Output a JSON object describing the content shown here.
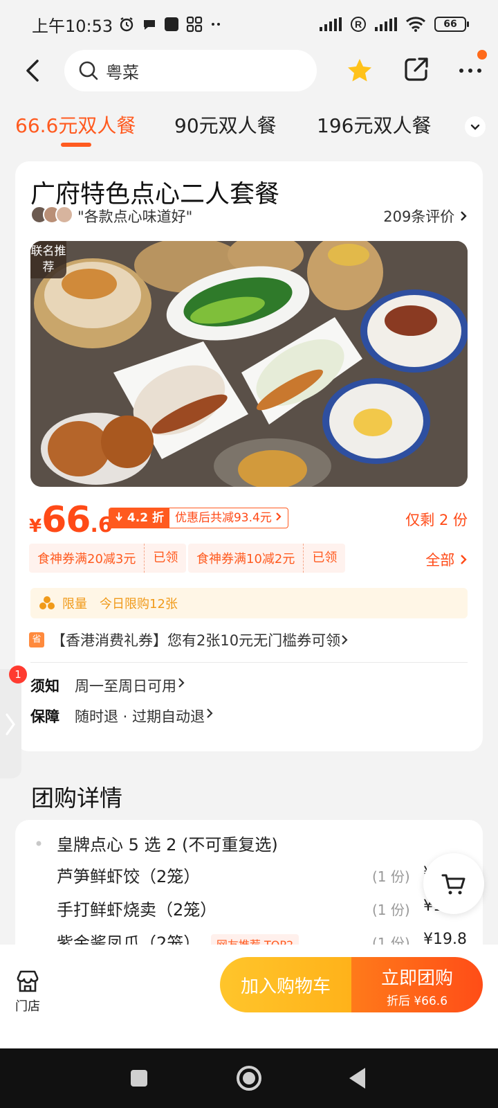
{
  "status_bar": {
    "time": "上午10:53",
    "battery": "66"
  },
  "search": {
    "query": "粤菜"
  },
  "tabs": [
    {
      "label": "66.6元双人餐",
      "active": true
    },
    {
      "label": "90元双人餐",
      "active": false
    },
    {
      "label": "196元双人餐",
      "active": false
    }
  ],
  "deal": {
    "title": "广府特色点心二人套餐",
    "review_quote": "\"各款点心味道好\"",
    "review_count": "209条评价",
    "photo_badge": "联名推荐",
    "price_currency": "¥",
    "price_int": "66",
    "price_dec": ".6",
    "discount_tag": "4.2 折",
    "discount_text": "优惠后共减93.4元",
    "remaining": "仅剩 2 份",
    "coupons": [
      {
        "label": "食神券满20减3元",
        "status": "已领"
      },
      {
        "label": "食神券满10减2元",
        "status": "已领"
      }
    ],
    "coupons_all": "全部",
    "limit_label": "限量",
    "limit_text": "今日限购12张",
    "hk_icon": "省",
    "hk_voucher": "【香港消费礼券】您有2张10元无门槛券可领",
    "notice_label": "须知",
    "notice_text": "周一至周日可用",
    "guarantee_label": "保障",
    "guarantee_text": "随时退 · 过期自动退"
  },
  "side_badge": "1",
  "details": {
    "section_title": "团购详情",
    "group_title": "皇牌点心 5 选 2 (不可重复选)",
    "items": [
      {
        "name": "芦笋鲜虾饺（2笼）",
        "qty": "(1 份)",
        "price": "¥"
      },
      {
        "name": "手打鲜虾烧卖（2笼）",
        "qty": "(1 份)",
        "price": "¥15.8"
      },
      {
        "name": "紫金酱凤爪（2笼）",
        "qty": "(1 份)",
        "price": "¥19.8",
        "tag": "网友推荐 TOP2"
      }
    ]
  },
  "bottom_bar": {
    "store_label": "门店",
    "add_cart": "加入购物车",
    "buy_now": "立即团购",
    "buy_sub": "折后 ¥66.6"
  },
  "colors": {
    "accent": "#ff5a1f",
    "cart_btn": "#ffb21a",
    "page_bg": "#f3f3f3"
  }
}
